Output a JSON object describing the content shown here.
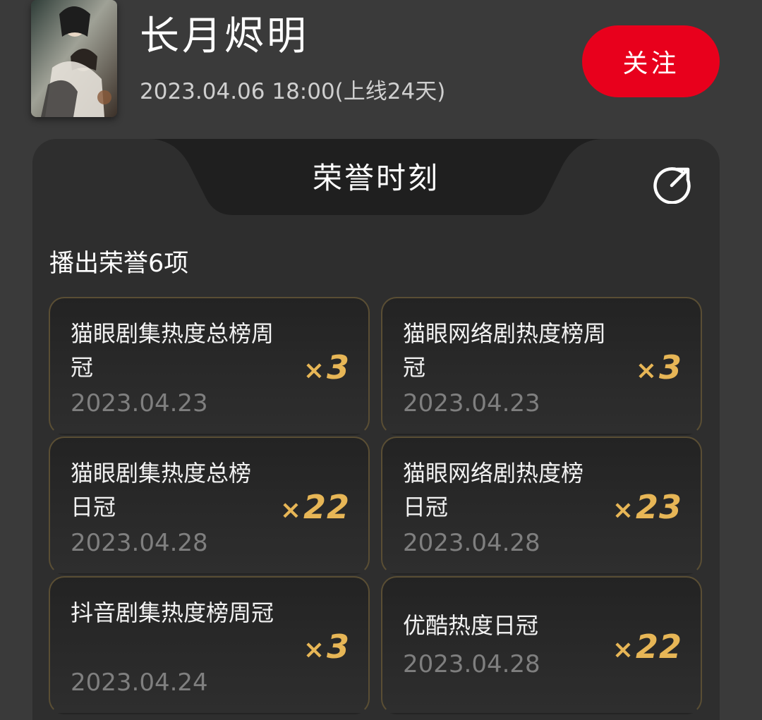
{
  "header": {
    "title": "长月烬明",
    "release_info": "2023.04.06 18:00(上线24天)",
    "follow_label": "关注"
  },
  "honor_panel": {
    "title": "荣誉时刻",
    "count_label": "播出荣誉6项",
    "cards": [
      {
        "name": "猫眼剧集热度总榜周冠",
        "date": "2023.04.23",
        "multiplier": "3"
      },
      {
        "name": "猫眼网络剧热度榜周冠",
        "date": "2023.04.23",
        "multiplier": "3"
      },
      {
        "name": "猫眼剧集热度总榜日冠",
        "date": "2023.04.28",
        "multiplier": "22"
      },
      {
        "name": "猫眼网络剧热度榜日冠",
        "date": "2023.04.28",
        "multiplier": "23"
      },
      {
        "name": "抖音剧集热度榜周冠",
        "date": "2023.04.24",
        "multiplier": "3"
      },
      {
        "name": "优酷热度日冠",
        "date": "2023.04.28",
        "multiplier": "22"
      }
    ]
  },
  "icons": {
    "share": "share-icon",
    "poster": "drama-poster"
  },
  "colors": {
    "background": "#3a3a3a",
    "panel": "#2e2e2e",
    "follow_button": "#e8001c",
    "multiplier_gold": "#e7b656",
    "card_border": "#5a4e34",
    "date_gray": "#7f7f7f"
  }
}
